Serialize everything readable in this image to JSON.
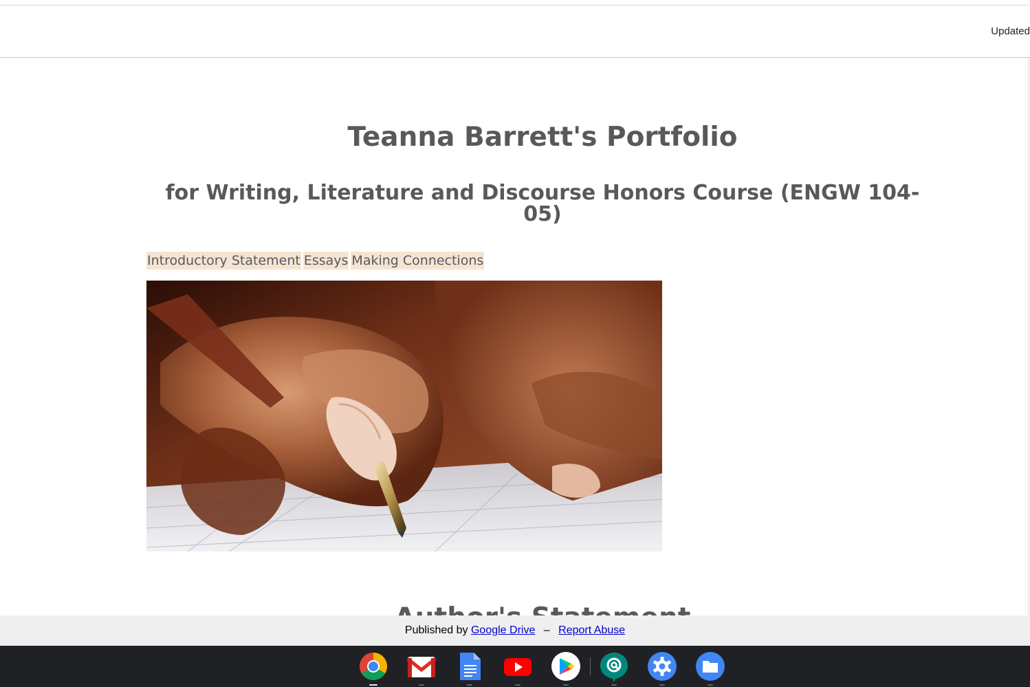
{
  "header": {
    "updated_text": "Updated"
  },
  "page": {
    "title": "Teanna Barrett's Portfolio",
    "subtitle": "for Writing, Literature and Discourse Honors Course (ENGW 104-05)",
    "nav": [
      {
        "label": "Introductory Statement"
      },
      {
        "label": "Essays"
      },
      {
        "label": "Making Connections"
      }
    ],
    "section_heading": "Author's Statement"
  },
  "footer": {
    "published_by": "Published by",
    "google_drive": "Google Drive",
    "separator": "–",
    "report_abuse": "Report Abuse"
  },
  "shelf": {
    "apps": [
      {
        "name": "chrome-icon",
        "active": true
      },
      {
        "name": "gmail-icon",
        "active": false
      },
      {
        "name": "docs-icon",
        "active": false
      },
      {
        "name": "youtube-icon",
        "active": false
      },
      {
        "name": "play-store-icon",
        "active": false
      },
      {
        "name": "google-chat-icon",
        "active": false
      },
      {
        "name": "settings-icon",
        "active": false
      },
      {
        "name": "files-icon",
        "active": false
      }
    ]
  },
  "colors": {
    "heading": "#595959",
    "nav_highlight": "#f6e4d3",
    "footer_bg": "#efefef",
    "shelf_bg": "#202124",
    "link": "#0000cc"
  }
}
